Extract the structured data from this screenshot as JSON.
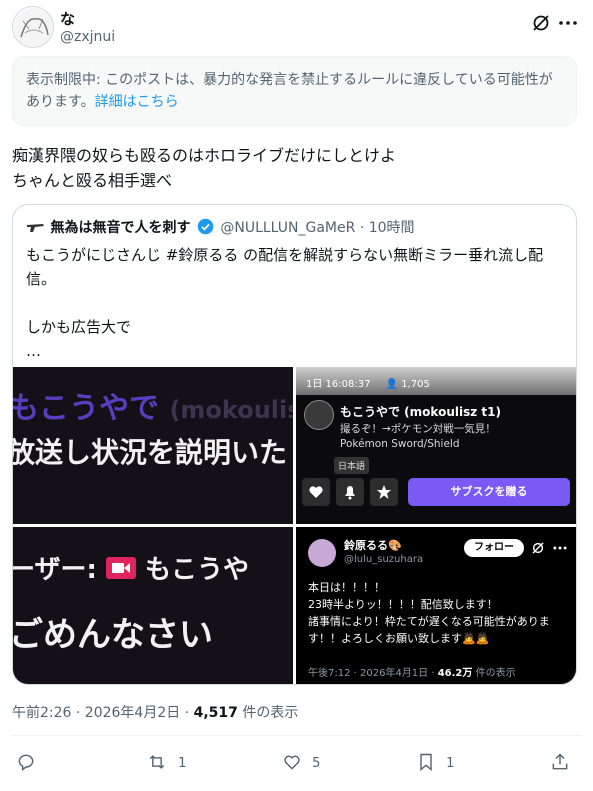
{
  "author": {
    "name": "な",
    "handle": "@zxjnui"
  },
  "notice": {
    "text": "表示制限中: このポストは、暴力的な発言を禁止するルールに違反している可能性があります。",
    "link": "詳細はこちら"
  },
  "tweet": {
    "line1": "痴漢界隈の奴らも殴るのはホロライブだけにしとけよ",
    "line2": "ちゃんと殴る相手選べ"
  },
  "quote": {
    "name": "無為は無音で人を刺す",
    "handle": "@NULLLUN_GaMeR",
    "time": "10時間",
    "body": "もこうがにじさんじ #鈴原るる の配信を解説すらない無断ミラー垂れ流し配信。\n\nしかも広告大で\n…",
    "images": {
      "img1_line1": "もこうやで",
      "img1_line1_faded": "(mokoulis",
      "img1_line2": "放送し状況を説明いた",
      "stream": {
        "time": "1日 16:08:37",
        "viewers": "1,705",
        "channel_name": "もこうやで (mokoulisz t1)",
        "title": "撮るぞ！→ポケモン対戦一気見！",
        "game": "Pokémon Sword/Shield",
        "tag": "日本語",
        "subscribe": "サブスクを贈る"
      },
      "img3_line1": "ーザー:",
      "img3_line1b": "もこうや",
      "img3_line2": "ごめんなさい",
      "inner_tweet": {
        "name": "鈴原るる🎨",
        "handle": "@lulu_suzuhara",
        "follow": "フォロー",
        "body": "本日は！！！！\n23時半よりッ！！！！配信致します！\n諸事情により！枠たてが遅くなる可能性があります！！よろしくお願い致します🙇🙇",
        "time": "午後7:12 · 2026年4月1日 ·",
        "views": "46.2万",
        "views_label": "件の表示"
      }
    }
  },
  "meta": {
    "time": "午前2:26 · 2026年4月2日 ·",
    "views": "4,517",
    "views_label": "件の表示"
  },
  "actions": {
    "reply": "",
    "retweets": "1",
    "likes": "5",
    "bookmarks": "1"
  }
}
